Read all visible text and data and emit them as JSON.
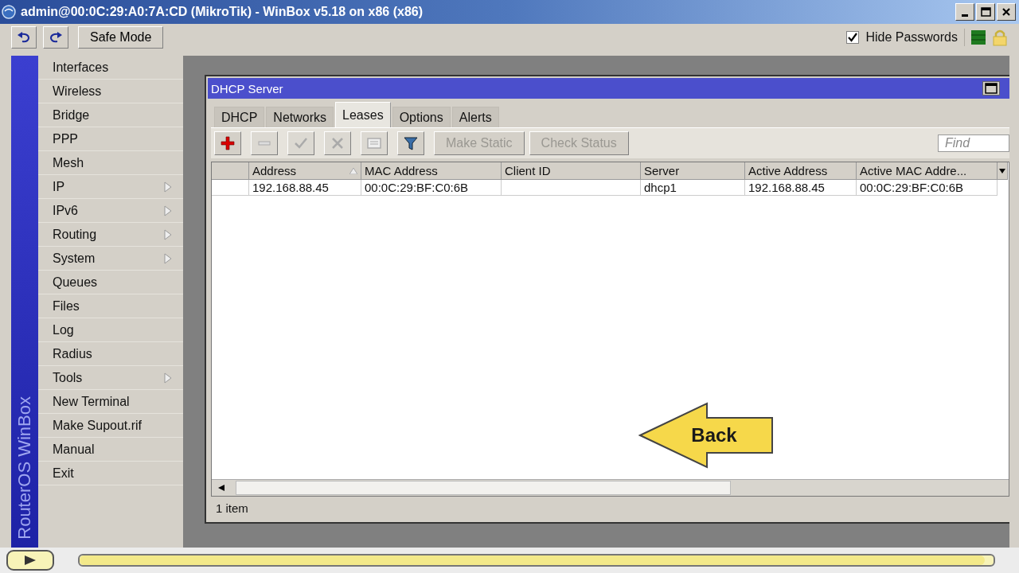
{
  "window": {
    "title": "admin@00:0C:29:A0:7A:CD (MikroTik) - WinBox v5.18 on x86 (x86)"
  },
  "toolbar": {
    "safe_mode": "Safe Mode",
    "hide_passwords": {
      "label": "Hide Passwords",
      "checked": true
    }
  },
  "sidebar": {
    "brand": "RouterOS WinBox",
    "items": [
      {
        "label": "Interfaces",
        "submenu": false
      },
      {
        "label": "Wireless",
        "submenu": false
      },
      {
        "label": "Bridge",
        "submenu": false
      },
      {
        "label": "PPP",
        "submenu": false
      },
      {
        "label": "Mesh",
        "submenu": false
      },
      {
        "label": "IP",
        "submenu": true
      },
      {
        "label": "IPv6",
        "submenu": true
      },
      {
        "label": "Routing",
        "submenu": true
      },
      {
        "label": "System",
        "submenu": true
      },
      {
        "label": "Queues",
        "submenu": false
      },
      {
        "label": "Files",
        "submenu": false
      },
      {
        "label": "Log",
        "submenu": false
      },
      {
        "label": "Radius",
        "submenu": false
      },
      {
        "label": "Tools",
        "submenu": true
      },
      {
        "label": "New Terminal",
        "submenu": false
      },
      {
        "label": "Make Supout.rif",
        "submenu": false
      },
      {
        "label": "Manual",
        "submenu": false
      },
      {
        "label": "Exit",
        "submenu": false
      }
    ]
  },
  "dhcp_window": {
    "title": "DHCP Server",
    "tabs": [
      {
        "label": "DHCP",
        "selected": false
      },
      {
        "label": "Networks",
        "selected": false
      },
      {
        "label": "Leases",
        "selected": true
      },
      {
        "label": "Options",
        "selected": false
      },
      {
        "label": "Alerts",
        "selected": false
      }
    ],
    "tools": [
      {
        "kind": "icon",
        "disabled": false
      },
      {
        "kind": "icon",
        "disabled": true
      },
      {
        "kind": "icon",
        "disabled": true
      },
      {
        "kind": "icon",
        "disabled": true
      },
      {
        "kind": "icon",
        "disabled": true
      },
      {
        "kind": "icon",
        "disabled": false
      },
      {
        "kind": "text",
        "label": "Make Static",
        "disabled": true
      },
      {
        "kind": "text",
        "label": "Check Status",
        "disabled": true
      }
    ],
    "find": {
      "placeholder": "Find"
    },
    "table": {
      "columns": [
        {
          "label": "Address",
          "sorted": true
        },
        {
          "label": "MAC Address",
          "sorted": false
        },
        {
          "label": "Client ID",
          "sorted": false
        },
        {
          "label": "Server",
          "sorted": false
        },
        {
          "label": "Active Address",
          "sorted": false
        },
        {
          "label": "Active MAC Addre...",
          "sorted": false
        }
      ],
      "rows": [
        {
          "cells": [
            "192.168.88.45",
            "00:0C:29:BF:C0:6B",
            null,
            "dhcp1",
            "192.168.88.45",
            "00:0C:29:BF:C0:6B"
          ]
        }
      ]
    },
    "status": "1 item"
  },
  "overlay": {
    "back_button": "Back"
  },
  "player": {
    "level": 0.99
  }
}
